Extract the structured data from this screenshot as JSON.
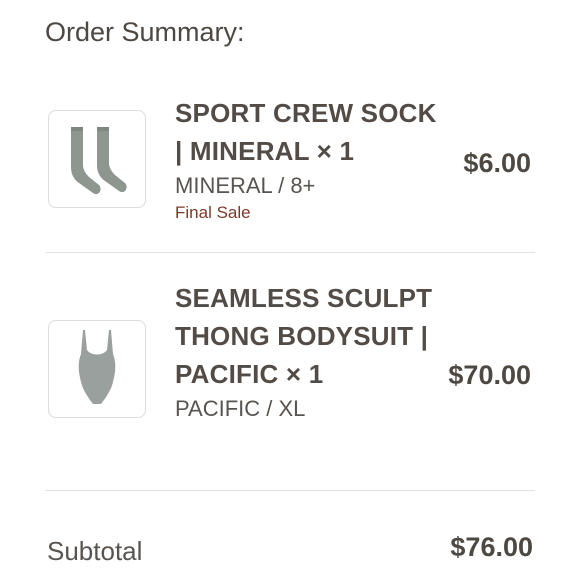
{
  "order_summary": {
    "title": "Order Summary:",
    "items": [
      {
        "name": "SPORT CREW SOCK | MINERAL × 1",
        "variant": "MINERAL / 8+",
        "badge": "Final Sale",
        "price": "$6.00",
        "thumb_icon": "socks-icon",
        "thumb_color": "#8e9690"
      },
      {
        "name": "SEAMLESS SCULPT THONG BODYSUIT | PACIFIC × 1",
        "variant": "PACIFIC / XL",
        "price": "$70.00",
        "thumb_icon": "bodysuit-icon",
        "thumb_color": "#9aa09e"
      }
    ],
    "subtotal_label": "Subtotal",
    "subtotal_value": "$76.00"
  }
}
